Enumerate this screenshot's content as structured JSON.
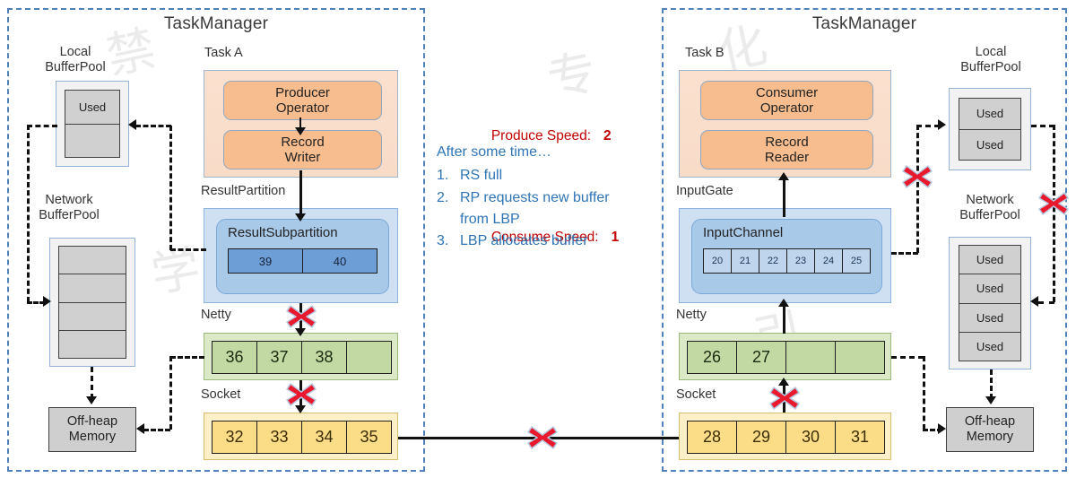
{
  "left_taskmanager": {
    "title": "TaskManager",
    "local_bufferpool": {
      "label": "Local\nBufferPool",
      "cells": [
        "Used",
        ""
      ]
    },
    "network_bufferpool": {
      "label": "Network\nBufferPool",
      "cells": [
        "",
        "",
        "",
        ""
      ]
    },
    "offheap": {
      "label": "Off-heap\nMemory"
    },
    "task": {
      "label": "Task A",
      "operator": "Producer\nOperator",
      "record": "Record\nWriter"
    },
    "result_partition": {
      "label": "ResultPartition",
      "subpartition_title": "ResultSubpartition",
      "cells": [
        "39",
        "40"
      ]
    },
    "netty": {
      "label": "Netty",
      "cells": [
        "36",
        "37",
        "38",
        ""
      ]
    },
    "socket": {
      "label": "Socket",
      "cells": [
        "32",
        "33",
        "34",
        "35"
      ]
    }
  },
  "right_taskmanager": {
    "title": "TaskManager",
    "local_bufferpool": {
      "label": "Local\nBufferPool",
      "cells": [
        "Used",
        "Used"
      ]
    },
    "network_bufferpool": {
      "label": "Network\nBufferPool",
      "cells": [
        "Used",
        "Used",
        "Used",
        "Used"
      ]
    },
    "offheap": {
      "label": "Off-heap\nMemory"
    },
    "task": {
      "label": "Task B",
      "operator": "Consumer\nOperator",
      "record": "Record\nReader"
    },
    "input_gate": {
      "label": "InputGate",
      "channel_title": "InputChannel",
      "cells": [
        "20",
        "21",
        "22",
        "23",
        "24",
        "25"
      ]
    },
    "netty": {
      "label": "Netty",
      "cells": [
        "26",
        "27",
        "",
        ""
      ]
    },
    "socket": {
      "label": "Socket",
      "cells": [
        "28",
        "29",
        "30",
        "31"
      ]
    }
  },
  "annotations": {
    "produce_speed_label": "Produce Speed:",
    "produce_speed_value": "2",
    "consume_speed_label": "Consume Speed:",
    "consume_speed_value": "1",
    "notes_header": "After some time…",
    "notes": [
      {
        "num": "1.",
        "text": "RS full"
      },
      {
        "num": "2.",
        "text": "RP requests new buffer\nfrom LBP"
      },
      {
        "num": "3.",
        "text": "LBP allocates buffer"
      }
    ]
  },
  "colors": {
    "taskmanager_border": "#4f81bd",
    "speed_text": "#c00000",
    "notes_text": "#2e74b5",
    "blocked_marker": "#e8192c",
    "task_fill": "#f7bd8f",
    "partition_fill": "#a9c9e9",
    "netty_fill": "#c3d9a4",
    "socket_fill": "#fbdd87",
    "pool_fill": "#d0d0d0"
  },
  "icons": {
    "blocked": "red-x-icon"
  }
}
